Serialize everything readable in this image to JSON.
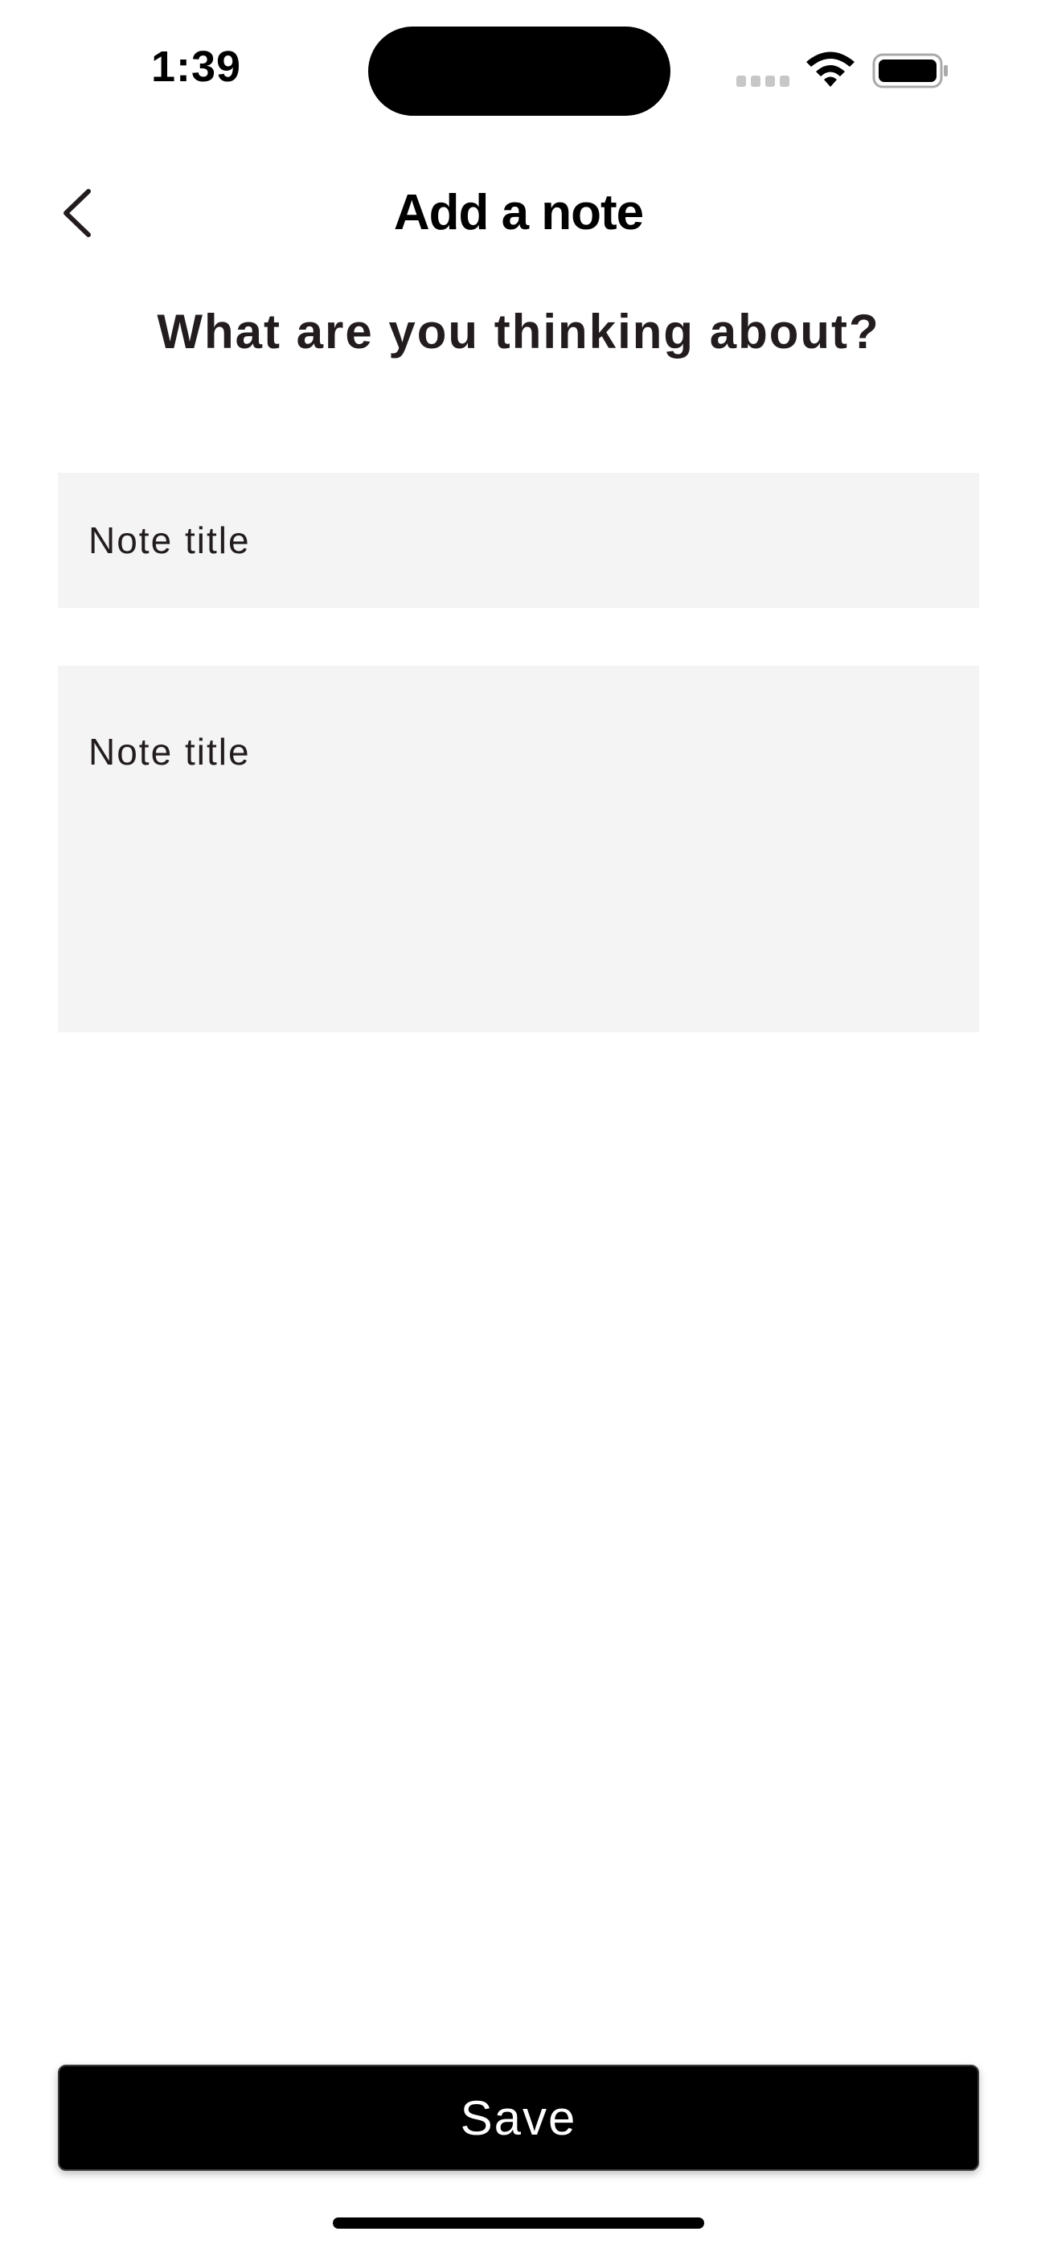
{
  "status_bar": {
    "time": "1:39",
    "icons": [
      "cellular-signal-icon",
      "wifi-icon",
      "battery-icon"
    ]
  },
  "header": {
    "title": "Add a note",
    "back_icon": "chevron-left-icon"
  },
  "main": {
    "subheading": "What are you thinking about?",
    "title_field": {
      "value": "",
      "placeholder": "Note title"
    },
    "body_field": {
      "value": "",
      "placeholder": "Note title"
    }
  },
  "footer": {
    "save_label": "Save"
  },
  "colors": {
    "background": "#ffffff",
    "text": "#221c1f",
    "field_background": "#f4f4f4",
    "button_background": "#000000",
    "button_text": "#ffffff"
  }
}
